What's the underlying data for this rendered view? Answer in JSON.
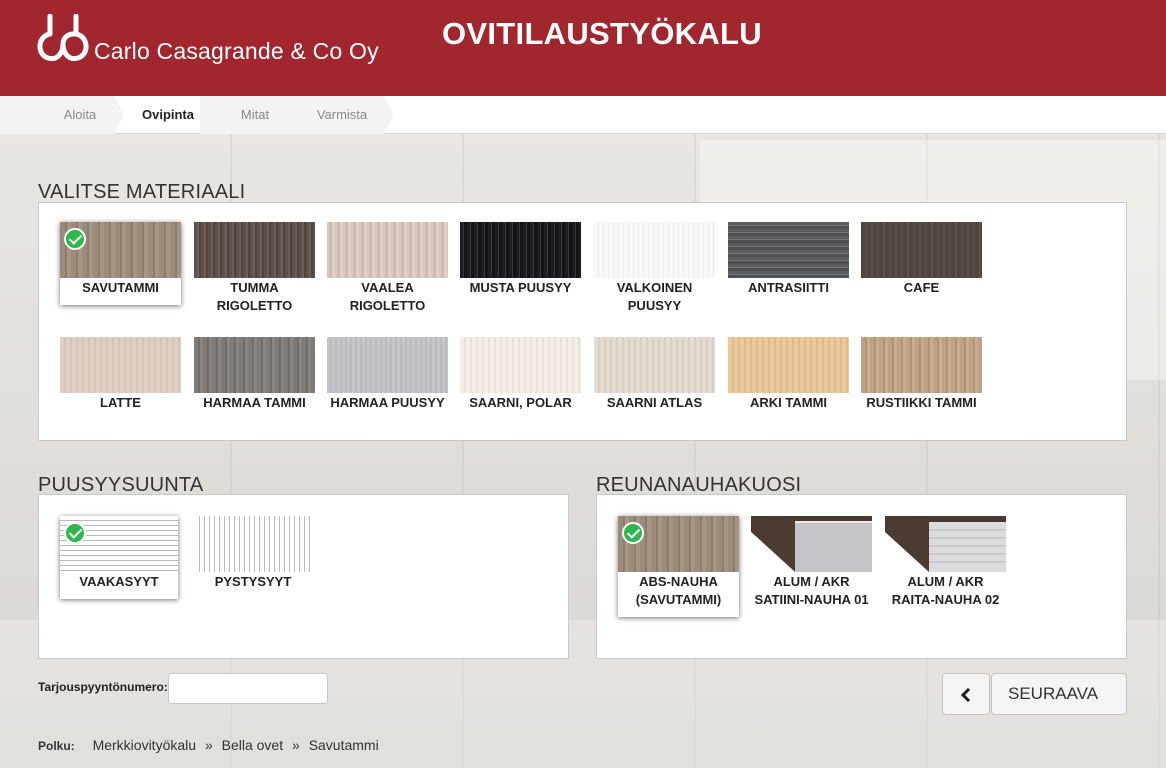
{
  "header": {
    "company": "Carlo Casagrande & Co Oy",
    "app_title": "OVITILAUSTYÖKALU",
    "bg_color": "#a2262d"
  },
  "steps": [
    {
      "label": "Aloita",
      "active": false
    },
    {
      "label": "Ovipinta",
      "active": true
    },
    {
      "label": "Mitat",
      "active": false
    },
    {
      "label": "Varmista",
      "active": false
    }
  ],
  "material": {
    "title": "VALITSE MATERIAALI",
    "items": [
      {
        "label": "SAVUTAMMI",
        "color": "#9a8878",
        "selected": true
      },
      {
        "label": "TUMMA RIGOLETTO",
        "color": "#5e514b",
        "selected": false
      },
      {
        "label": "VAALEA RIGOLETTO",
        "color": "#d6c6bb",
        "selected": false
      },
      {
        "label": "MUSTA PUUSYY",
        "color": "#1e1e22",
        "selected": false
      },
      {
        "label": "VALKOINEN PUUSYY",
        "color": "#f6f6f6",
        "selected": false
      },
      {
        "label": "ANTRASIITTI",
        "color": "#5b5c60",
        "selected": false
      },
      {
        "label": "CAFE",
        "color": "#4f4540",
        "selected": false
      },
      {
        "label": "LATTE",
        "color": "#e0d0c3",
        "selected": false
      },
      {
        "label": "HARMAA TAMMI",
        "color": "#807b76",
        "selected": false
      },
      {
        "label": "HARMAA PUUSYY",
        "color": "#c6c6ca",
        "selected": false
      },
      {
        "label": "SAARNI, POLAR",
        "color": "#f1ece4",
        "selected": false
      },
      {
        "label": "SAARNI ATLAS",
        "color": "#e6ddd2",
        "selected": false
      },
      {
        "label": "ARKI TAMMI",
        "color": "#e9c79b",
        "selected": false
      },
      {
        "label": "RUSTIIKKI TAMMI",
        "color": "#bfa284",
        "selected": false
      }
    ]
  },
  "grain": {
    "title": "PUUSYYSUUNTA",
    "items": [
      {
        "label": "VAAKASYYT",
        "pattern": "horizontal",
        "selected": true
      },
      {
        "label": "PYSTYSYYT",
        "pattern": "vertical",
        "selected": false
      }
    ]
  },
  "edge": {
    "title": "REUNANAUHAKUOSI",
    "items": [
      {
        "label": "ABS-NAUHA (SAVUTAMMI)",
        "color": "#9a8878",
        "selected": true
      },
      {
        "label": "ALUM / AKR SATIINI-NAUHA 01",
        "color": "#c2c2c6",
        "selected": false
      },
      {
        "label": "ALUM / AKR RAITA-NAUHA 02",
        "color": "#d9d9dc",
        "selected": false
      }
    ]
  },
  "form": {
    "quote_label": "Tarjouspyyntönumero:",
    "quote_value": ""
  },
  "nav": {
    "next_label": "SEURAAVA"
  },
  "path": {
    "label": "Polku:",
    "items": [
      "Merkkiovityökalu",
      "Bella ovet",
      "Savutammi"
    ],
    "separator": "»"
  }
}
